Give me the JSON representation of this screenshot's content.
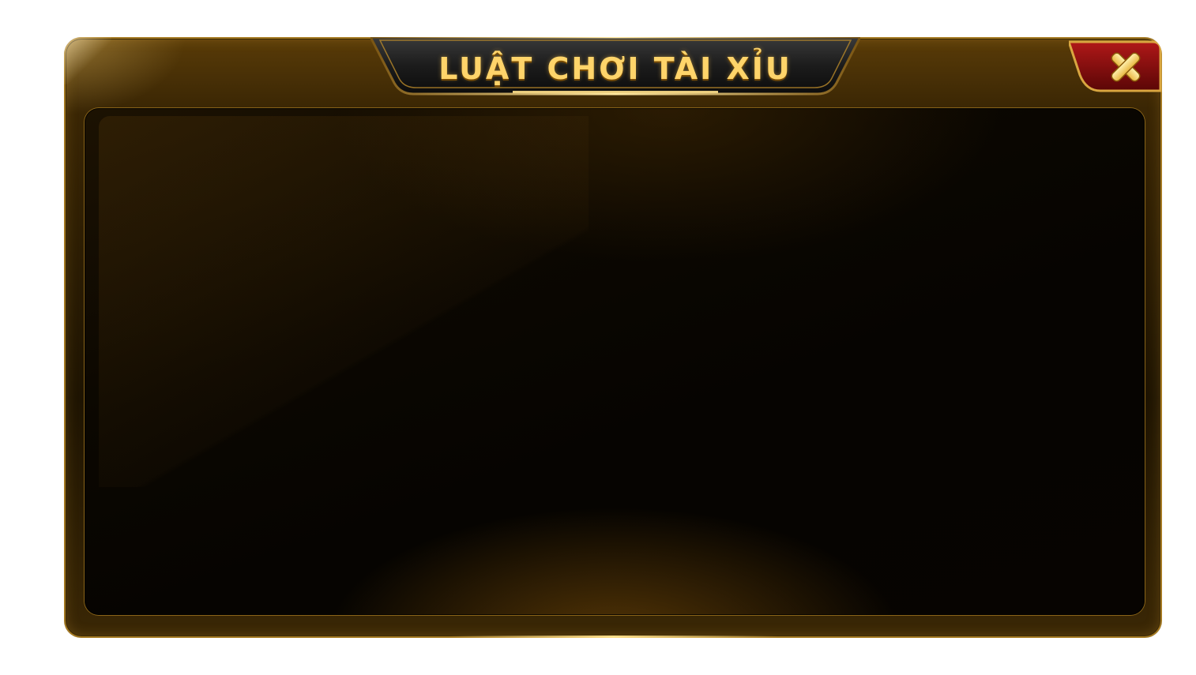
{
  "dialog": {
    "title": "LUẬT CHƠI TÀI XỈU",
    "close_icon": "close-icon"
  },
  "colors": {
    "frame_gold": "#a57a22",
    "title_text": "#ffd46a",
    "close_red": "#8a0f0f",
    "close_x": "#ffd866",
    "panel_dark": "#060401"
  }
}
